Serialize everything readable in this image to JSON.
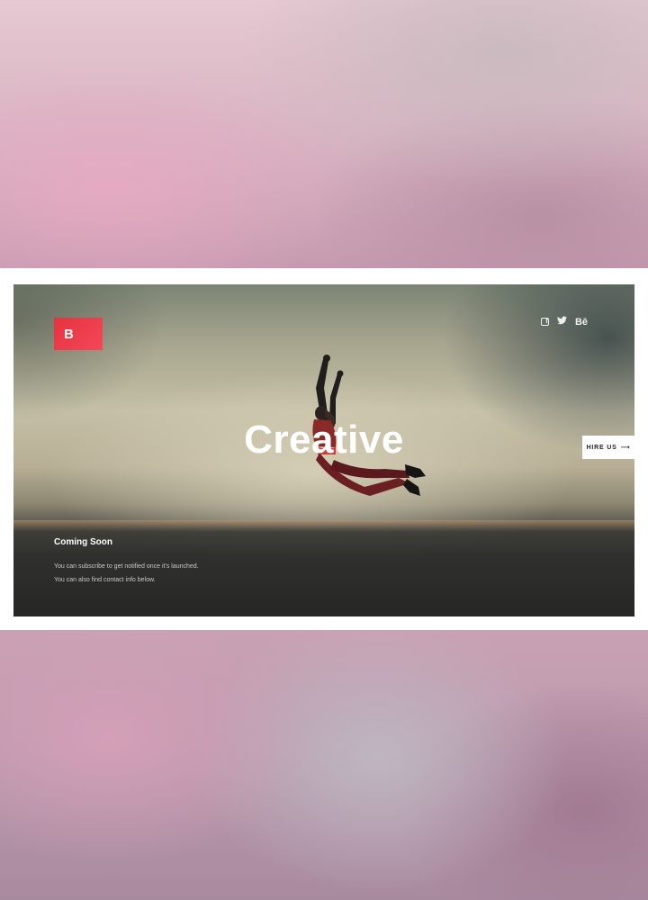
{
  "brand": {
    "logo_letter": "B",
    "accent": "#e8323e"
  },
  "social": {
    "icons": [
      "facebook-icon",
      "twitter-icon",
      "behance-icon"
    ],
    "behance_label": "Bē",
    "twitter_glyph": "🐦"
  },
  "hero": {
    "headline": "Creative",
    "hire_label": "HIRE US",
    "hire_arrow": "⟶",
    "coming_title": "Coming Soon",
    "desc_line1": "You can subscribe to get notified once it's launched.",
    "desc_line2": "You can also find contact info below."
  }
}
